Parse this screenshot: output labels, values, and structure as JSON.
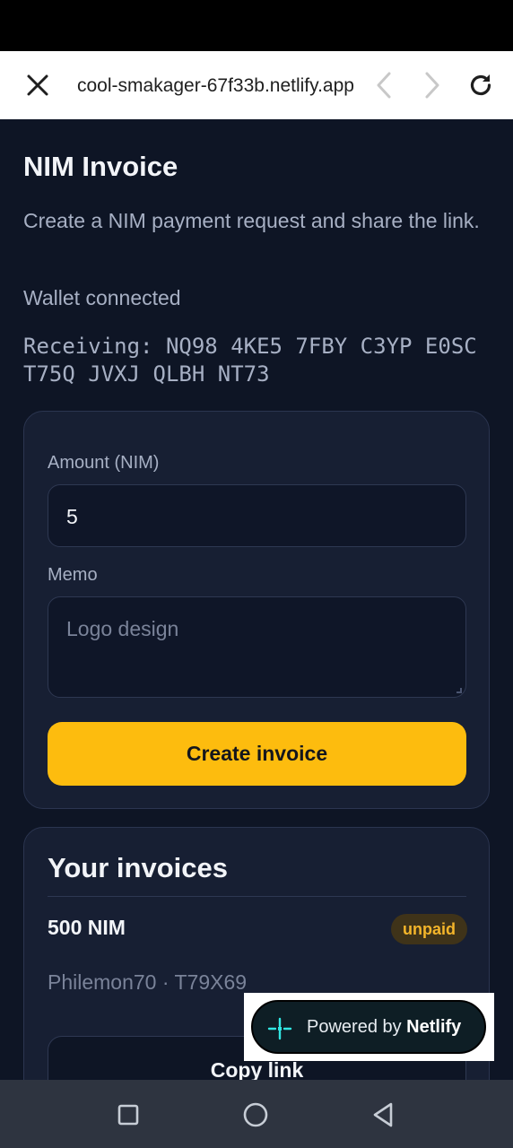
{
  "browser": {
    "url": "cool-smakager-67f33b.netlify.app",
    "icons": {
      "close": "close-icon",
      "back": "chevron-left-icon",
      "forward": "chevron-right-icon",
      "reload": "reload-icon"
    }
  },
  "page": {
    "title": "NIM Invoice",
    "subtitle": "Create a NIM payment request and share the link.",
    "wallet_status": "Wallet connected",
    "receiving": "Receiving: NQ98 4KE5 7FBY C3YP E0SC T75Q JVXJ QLBH NT73"
  },
  "form": {
    "amount_label": "Amount (NIM)",
    "amount_value": "5",
    "memo_label": "Memo",
    "memo_placeholder": "Logo design",
    "create_button": "Create invoice"
  },
  "invoices": {
    "title": "Your invoices",
    "items": [
      {
        "amount": "500 NIM",
        "status": "unpaid",
        "meta": "Philemon70 · T79X69",
        "copy_label": "Copy link"
      }
    ]
  },
  "netlify_badge": {
    "prefix": "Powered by ",
    "brand": "Netlify"
  },
  "colors": {
    "accent": "#fdbc0e",
    "background": "#0e1525",
    "card": "#171f33",
    "badge_text": "#f4b52a"
  }
}
